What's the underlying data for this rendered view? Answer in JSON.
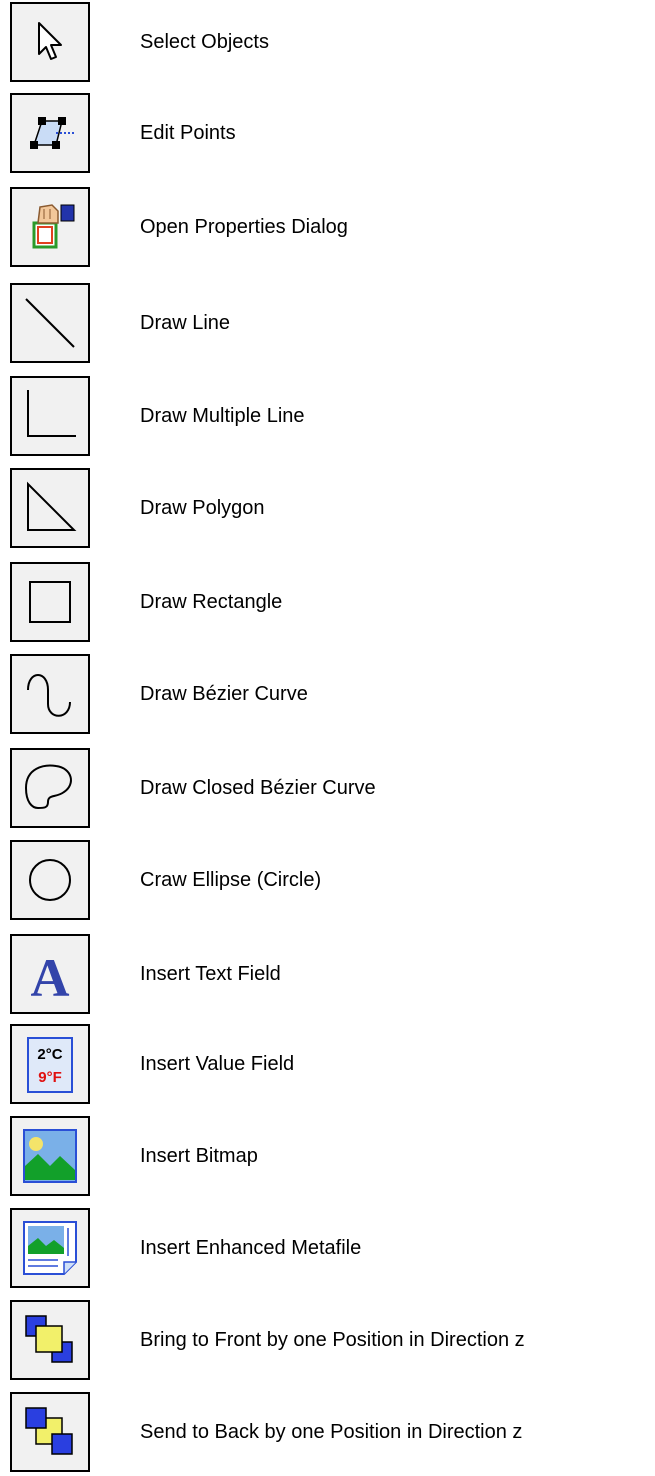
{
  "tools": [
    {
      "icon": "select-arrow-icon",
      "label": "Select Objects"
    },
    {
      "icon": "edit-points-icon",
      "label": "Edit Points"
    },
    {
      "icon": "properties-icon",
      "label": "Open Properties Dialog"
    },
    {
      "icon": "line-icon",
      "label": "Draw Line"
    },
    {
      "icon": "multiple-line-icon",
      "label": "Draw Multiple Line"
    },
    {
      "icon": "polygon-icon",
      "label": "Draw Polygon"
    },
    {
      "icon": "rectangle-icon",
      "label": "Draw Rectangle"
    },
    {
      "icon": "bezier-curve-icon",
      "label": "Draw Bézier Curve"
    },
    {
      "icon": "closed-bezier-icon",
      "label": "Draw Closed Bézier Curve"
    },
    {
      "icon": "ellipse-icon",
      "label": "Craw Ellipse (Circle)"
    },
    {
      "icon": "text-field-icon",
      "label": "Insert Text Field",
      "glyph": "A"
    },
    {
      "icon": "value-field-icon",
      "label": "Insert Value Field",
      "glyph_line1": "2°C",
      "glyph_line2": "9°F"
    },
    {
      "icon": "bitmap-icon",
      "label": "Insert Bitmap"
    },
    {
      "icon": "metafile-icon",
      "label": "Insert Enhanced Metafile"
    },
    {
      "icon": "bring-front-icon",
      "label": "Bring to Front by one Position in Direction z"
    },
    {
      "icon": "send-back-icon",
      "label": "Send to Back by one Position in Direction z"
    }
  ]
}
